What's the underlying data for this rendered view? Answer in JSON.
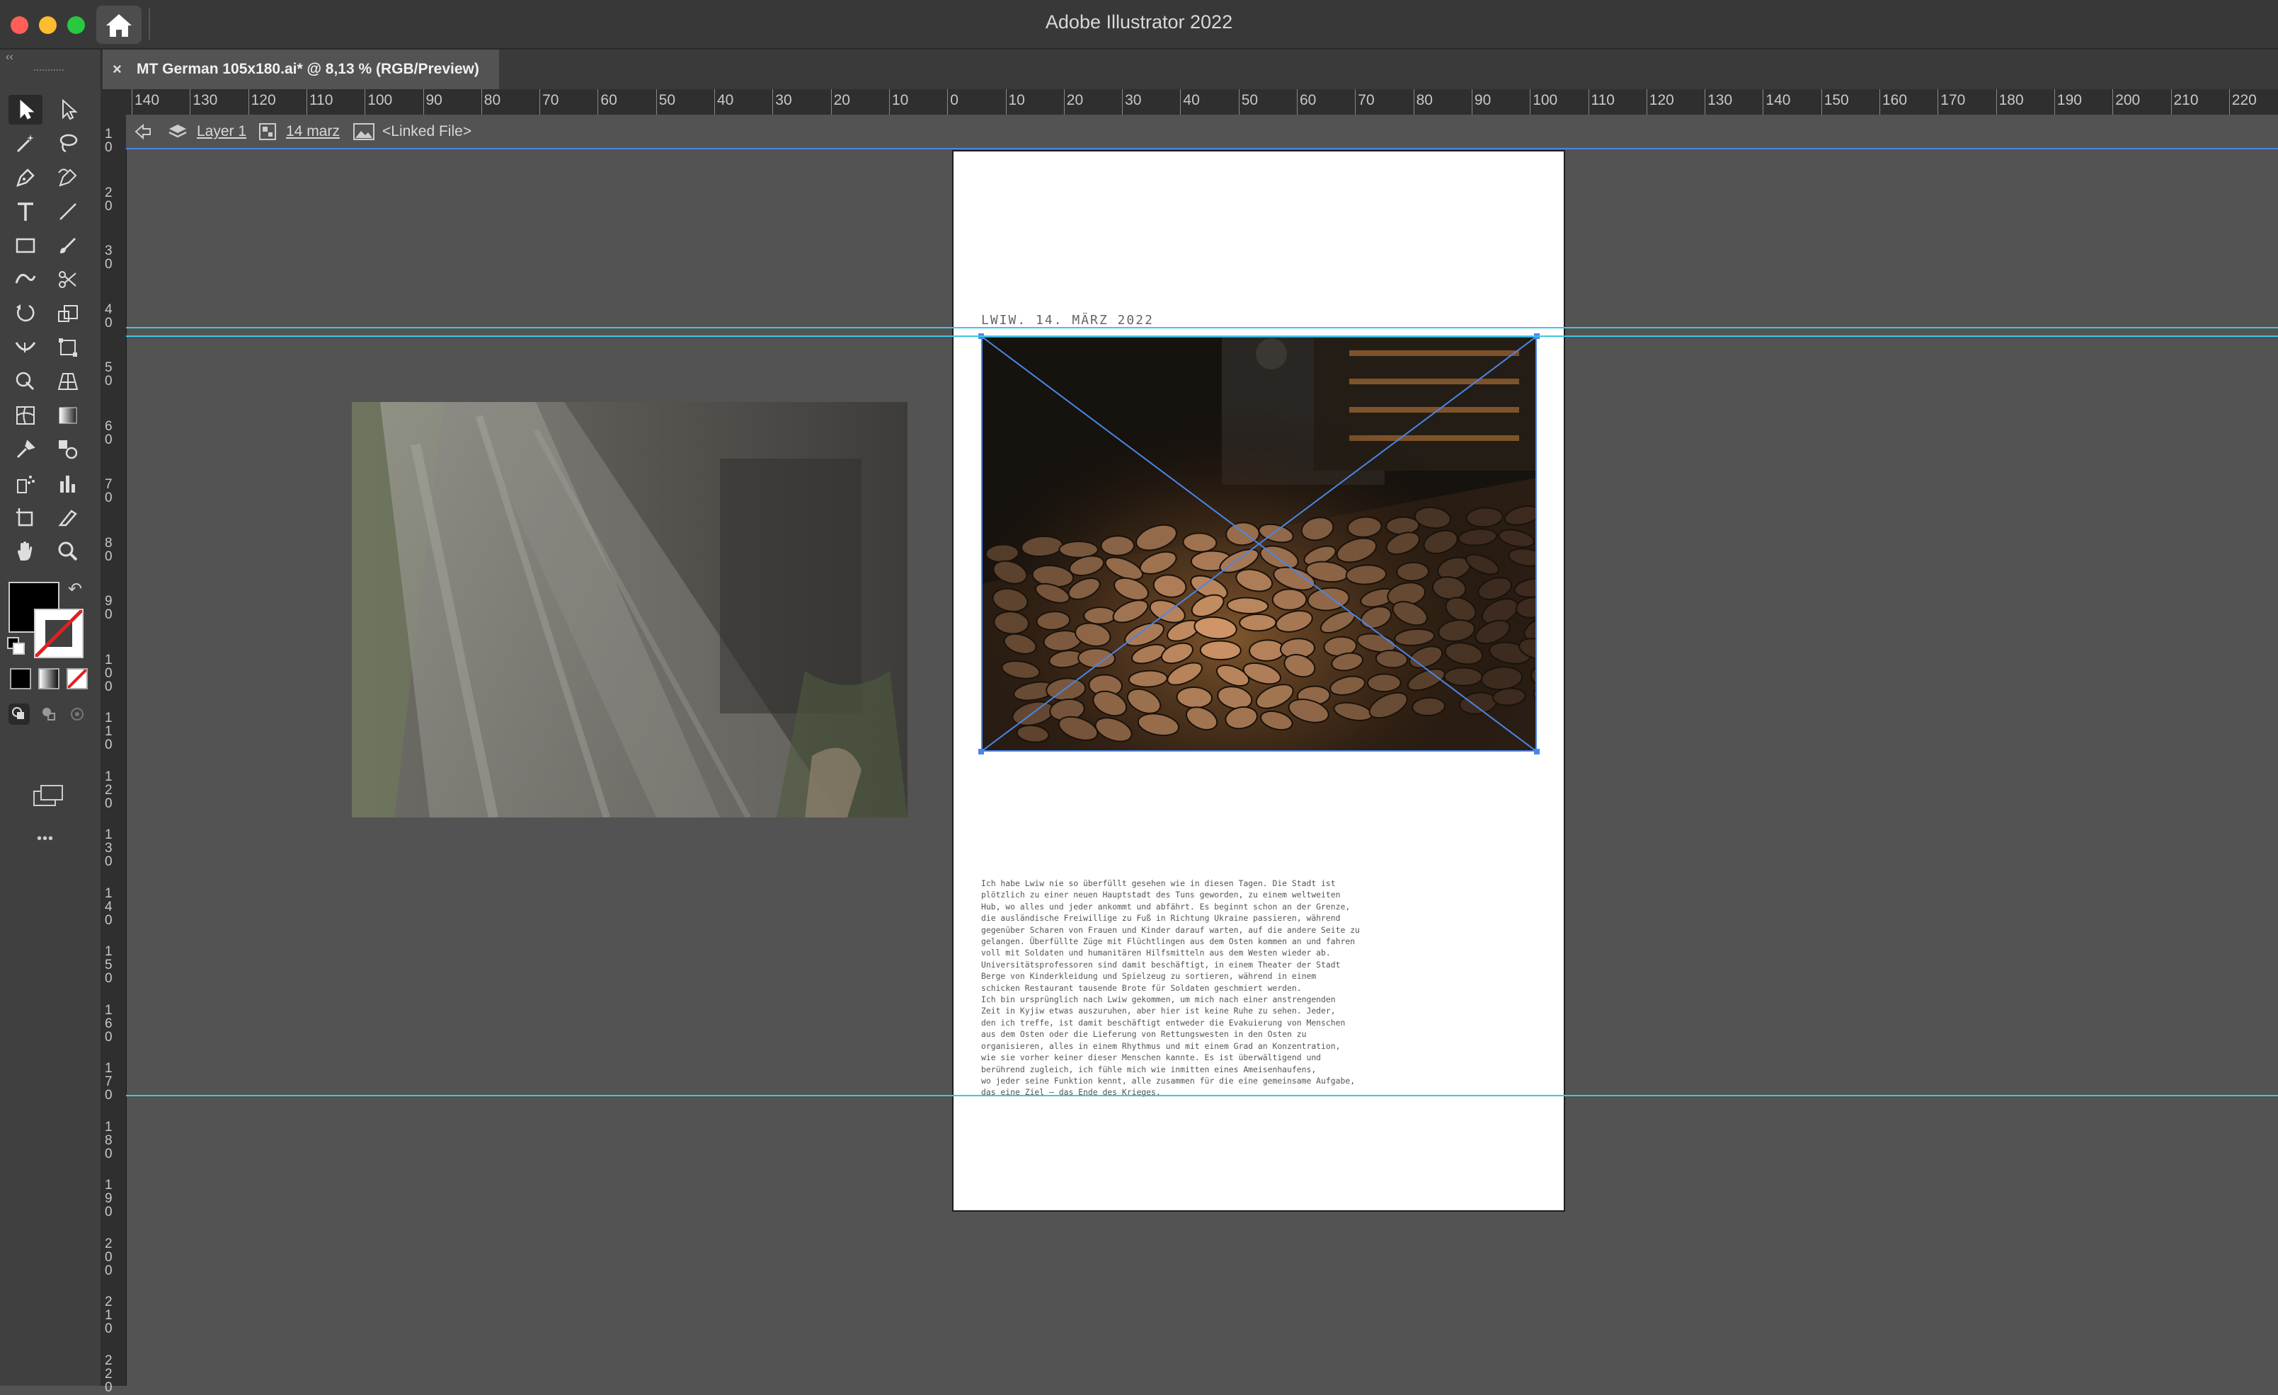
{
  "window": {
    "title": "Adobe Illustrator 2022",
    "traffic_colors": [
      "#ff5f57",
      "#febc2e",
      "#28c840"
    ]
  },
  "document_tab": {
    "title": "MT German 105x180.ai* @ 8,13 % (RGB/Preview)",
    "close_glyph": "×",
    "collapse_glyph": "‹‹"
  },
  "ruler": {
    "horizontal_labels": [
      "140",
      "130",
      "120",
      "110",
      "100",
      "90",
      "80",
      "70",
      "60",
      "50",
      "40",
      "30",
      "20",
      "10",
      "0",
      "10",
      "20",
      "30",
      "40",
      "50",
      "60",
      "70",
      "80",
      "90",
      "100",
      "110",
      "120",
      "130",
      "140",
      "150",
      "160",
      "170",
      "180",
      "190",
      "200",
      "210",
      "220"
    ],
    "vertical_labels": [
      "10",
      "20",
      "30",
      "40",
      "50",
      "60",
      "70",
      "80",
      "90",
      "100",
      "110",
      "120",
      "130",
      "140",
      "150",
      "160",
      "170",
      "180",
      "190",
      "200",
      "210",
      "220"
    ]
  },
  "control_bar": {
    "layer": "Layer 1",
    "group": "14 marz",
    "object": "<Linked File>"
  },
  "toolbar": {
    "icons": [
      "selection-icon",
      "direct-selection-icon",
      "magic-wand-icon",
      "lasso-icon",
      "pen-icon",
      "curvature-icon",
      "type-icon",
      "line-segment-icon",
      "rectangle-icon",
      "paintbrush-icon",
      "shaper-icon",
      "scissors-icon",
      "rotate-icon",
      "scale-icon",
      "width-icon",
      "free-transform-icon",
      "shape-builder-icon",
      "perspective-grid-icon",
      "mesh-icon",
      "gradient-icon",
      "eyedropper-icon",
      "blend-icon",
      "symbol-sprayer-icon",
      "column-graph-icon",
      "artboard-icon",
      "slice-icon",
      "hand-icon",
      "zoom-icon"
    ],
    "fill_color": "#000000",
    "more_glyph": "•••"
  },
  "artboard": {
    "dateline": "LWIW. 14. MÄRZ 2022",
    "body_lines": [
      "Ich habe Lwiw nie so überfüllt gesehen wie in diesen Tagen. Die Stadt ist",
      "plötzlich zu einer neuen Hauptstadt des Tuns geworden, zu einem weltweiten",
      "Hub, wo alles und jeder ankommt und abfährt. Es beginnt schon an der Grenze,",
      "die ausländische Freiwillige zu Fuß in Richtung Ukraine passieren, während",
      "gegenüber Scharen von Frauen und Kinder darauf warten, auf die andere Seite zu",
      "gelangen. Überfüllte Züge mit Flüchtlingen aus dem Osten kommen an und fahren",
      "voll mit Soldaten und humanitären Hilfsmitteln aus dem Westen wieder ab.",
      "Universitätsprofessoren sind damit beschäftigt, in einem Theater der Stadt",
      "Berge von Kinderkleidung und Spielzeug zu sortieren, während in einem",
      "schicken Restaurant tausende Brote für Soldaten geschmiert werden.",
      "Ich bin ursprünglich nach Lwiw gekommen, um mich nach einer anstrengenden",
      "Zeit in Kyjiw etwas auszuruhen, aber hier ist keine Ruhe zu sehen. Jeder,",
      "den ich treffe, ist damit beschäftigt entweder die Evakuierung von Menschen",
      "aus dem Osten oder die Lieferung von Rettungswesten in den Osten zu",
      "organisieren, alles in einem Rhythmus und mit einem Grad an Konzentration,",
      "wie sie vorher keiner dieser Menschen kannte. Es ist überwältigend und",
      "berührend zugleich, ich fühle mich wie inmitten eines Ameisenhaufens,",
      "wo jeder seine Funktion kennt, alle zusammen für die eine gemeinsame Aufgabe,",
      "das eine Ziel – das Ende des Krieges."
    ]
  }
}
